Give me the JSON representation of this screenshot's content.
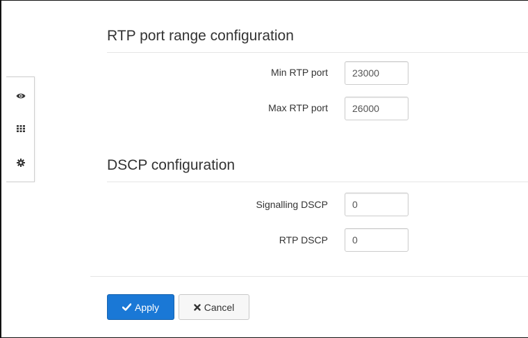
{
  "rtp": {
    "title": "RTP port range configuration",
    "min_label": "Min RTP port",
    "min_value": "23000",
    "max_label": "Max RTP port",
    "max_value": "26000"
  },
  "dscp": {
    "title": "DSCP configuration",
    "signalling_label": "Signalling DSCP",
    "signalling_value": "0",
    "rtp_label": "RTP DSCP",
    "rtp_value": "0"
  },
  "actions": {
    "apply_label": "Apply",
    "cancel_label": "Cancel"
  },
  "sidebar": {
    "icons": [
      "eye-icon",
      "grid-icon",
      "gear-icon"
    ]
  },
  "colors": {
    "primary": "#1a78d6",
    "default_button": "#f7f7f7"
  }
}
